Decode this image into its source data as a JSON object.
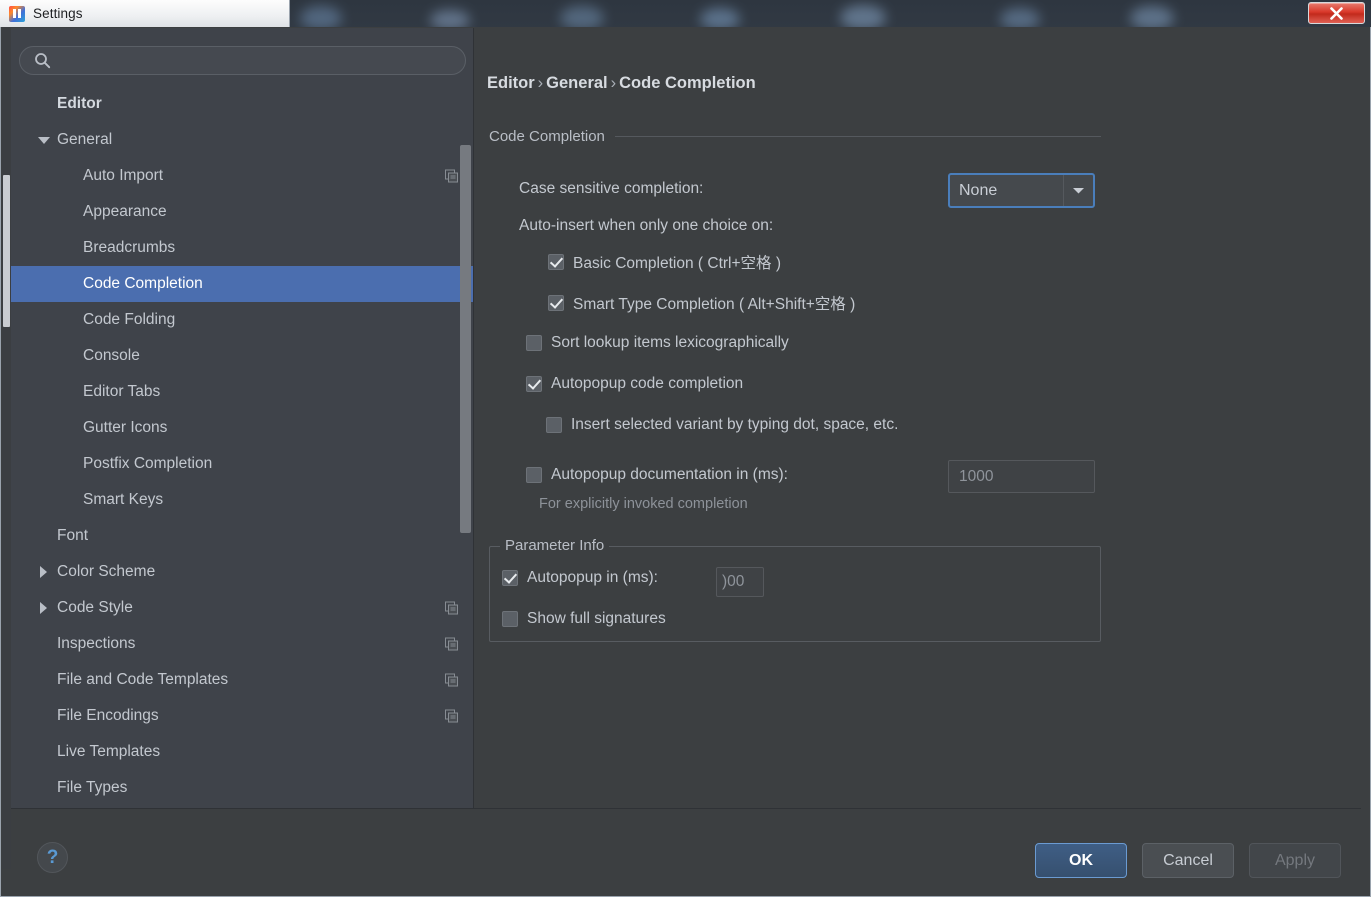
{
  "window": {
    "title": "Settings",
    "app_icon": "intellij-idea-icon",
    "close_icon": "close-icon"
  },
  "search": {
    "value": "",
    "placeholder": "",
    "icon": "search-icon"
  },
  "sidebar": {
    "scope_badge_icon": "project-scope-icon",
    "items": [
      {
        "label": "Editor",
        "indent": 0,
        "twisty": "none",
        "bold": true,
        "selected": false,
        "badge": false
      },
      {
        "label": "General",
        "indent": 1,
        "twisty": "down",
        "bold": false,
        "selected": false,
        "badge": false
      },
      {
        "label": "Auto Import",
        "indent": 2,
        "twisty": "none",
        "bold": false,
        "selected": false,
        "badge": true
      },
      {
        "label": "Appearance",
        "indent": 2,
        "twisty": "none",
        "bold": false,
        "selected": false,
        "badge": false
      },
      {
        "label": "Breadcrumbs",
        "indent": 2,
        "twisty": "none",
        "bold": false,
        "selected": false,
        "badge": false
      },
      {
        "label": "Code Completion",
        "indent": 2,
        "twisty": "none",
        "bold": false,
        "selected": true,
        "badge": false
      },
      {
        "label": "Code Folding",
        "indent": 2,
        "twisty": "none",
        "bold": false,
        "selected": false,
        "badge": false
      },
      {
        "label": "Console",
        "indent": 2,
        "twisty": "none",
        "bold": false,
        "selected": false,
        "badge": false
      },
      {
        "label": "Editor Tabs",
        "indent": 2,
        "twisty": "none",
        "bold": false,
        "selected": false,
        "badge": false
      },
      {
        "label": "Gutter Icons",
        "indent": 2,
        "twisty": "none",
        "bold": false,
        "selected": false,
        "badge": false
      },
      {
        "label": "Postfix Completion",
        "indent": 2,
        "twisty": "none",
        "bold": false,
        "selected": false,
        "badge": false
      },
      {
        "label": "Smart Keys",
        "indent": 2,
        "twisty": "none",
        "bold": false,
        "selected": false,
        "badge": false
      },
      {
        "label": "Font",
        "indent": 1,
        "twisty": "none",
        "bold": false,
        "selected": false,
        "badge": false
      },
      {
        "label": "Color Scheme",
        "indent": 1,
        "twisty": "right",
        "bold": false,
        "selected": false,
        "badge": false
      },
      {
        "label": "Code Style",
        "indent": 1,
        "twisty": "right",
        "bold": false,
        "selected": false,
        "badge": true
      },
      {
        "label": "Inspections",
        "indent": 1,
        "twisty": "none",
        "bold": false,
        "selected": false,
        "badge": true
      },
      {
        "label": "File and Code Templates",
        "indent": 1,
        "twisty": "none",
        "bold": false,
        "selected": false,
        "badge": true
      },
      {
        "label": "File Encodings",
        "indent": 1,
        "twisty": "none",
        "bold": false,
        "selected": false,
        "badge": true
      },
      {
        "label": "Live Templates",
        "indent": 1,
        "twisty": "none",
        "bold": false,
        "selected": false,
        "badge": false
      },
      {
        "label": "File Types",
        "indent": 1,
        "twisty": "none",
        "bold": false,
        "selected": false,
        "badge": false
      }
    ]
  },
  "main": {
    "breadcrumb": {
      "root": "Editor",
      "middle": "General",
      "leaf": "Code Completion",
      "separator": "›"
    },
    "section_title": "Code Completion",
    "case_sensitive": {
      "label": "Case sensitive completion:",
      "value": "None",
      "arrow_icon": "chevron-down-icon"
    },
    "auto_insert_label": "Auto-insert when only one choice on:",
    "basic_completion": {
      "label": "Basic Completion ( Ctrl+空格 )",
      "checked": true
    },
    "smart_type_completion": {
      "label": "Smart Type Completion ( Alt+Shift+空格 )",
      "checked": true
    },
    "sort_lookup": {
      "label": "Sort lookup items lexicographically",
      "checked": false
    },
    "autopopup_code_completion": {
      "label": "Autopopup code completion",
      "checked": true
    },
    "insert_selected_variant": {
      "label": "Insert selected variant by typing dot, space, etc.",
      "checked": false
    },
    "autopopup_documentation": {
      "label": "Autopopup documentation in (ms):",
      "checked": false,
      "value": "1000"
    },
    "explicit_hint": "For explicitly invoked completion",
    "parameter_info": {
      "legend": "Parameter Info",
      "autopopup": {
        "label": "Autopopup in (ms):",
        "checked": true,
        "value": ")00"
      },
      "show_full_signatures": {
        "label": "Show full signatures",
        "checked": false
      }
    }
  },
  "footer": {
    "help_label": "?",
    "ok_label": "OK",
    "cancel_label": "Cancel",
    "apply_label": "Apply"
  },
  "colors": {
    "selection_blue": "#4b6eaf",
    "panel_bg": "#3c3f41",
    "sidebar_bg": "#3f434a",
    "focus_border": "#4a7ebb",
    "close_red": "#d9382a",
    "help_blue": "#5a9ad4"
  }
}
